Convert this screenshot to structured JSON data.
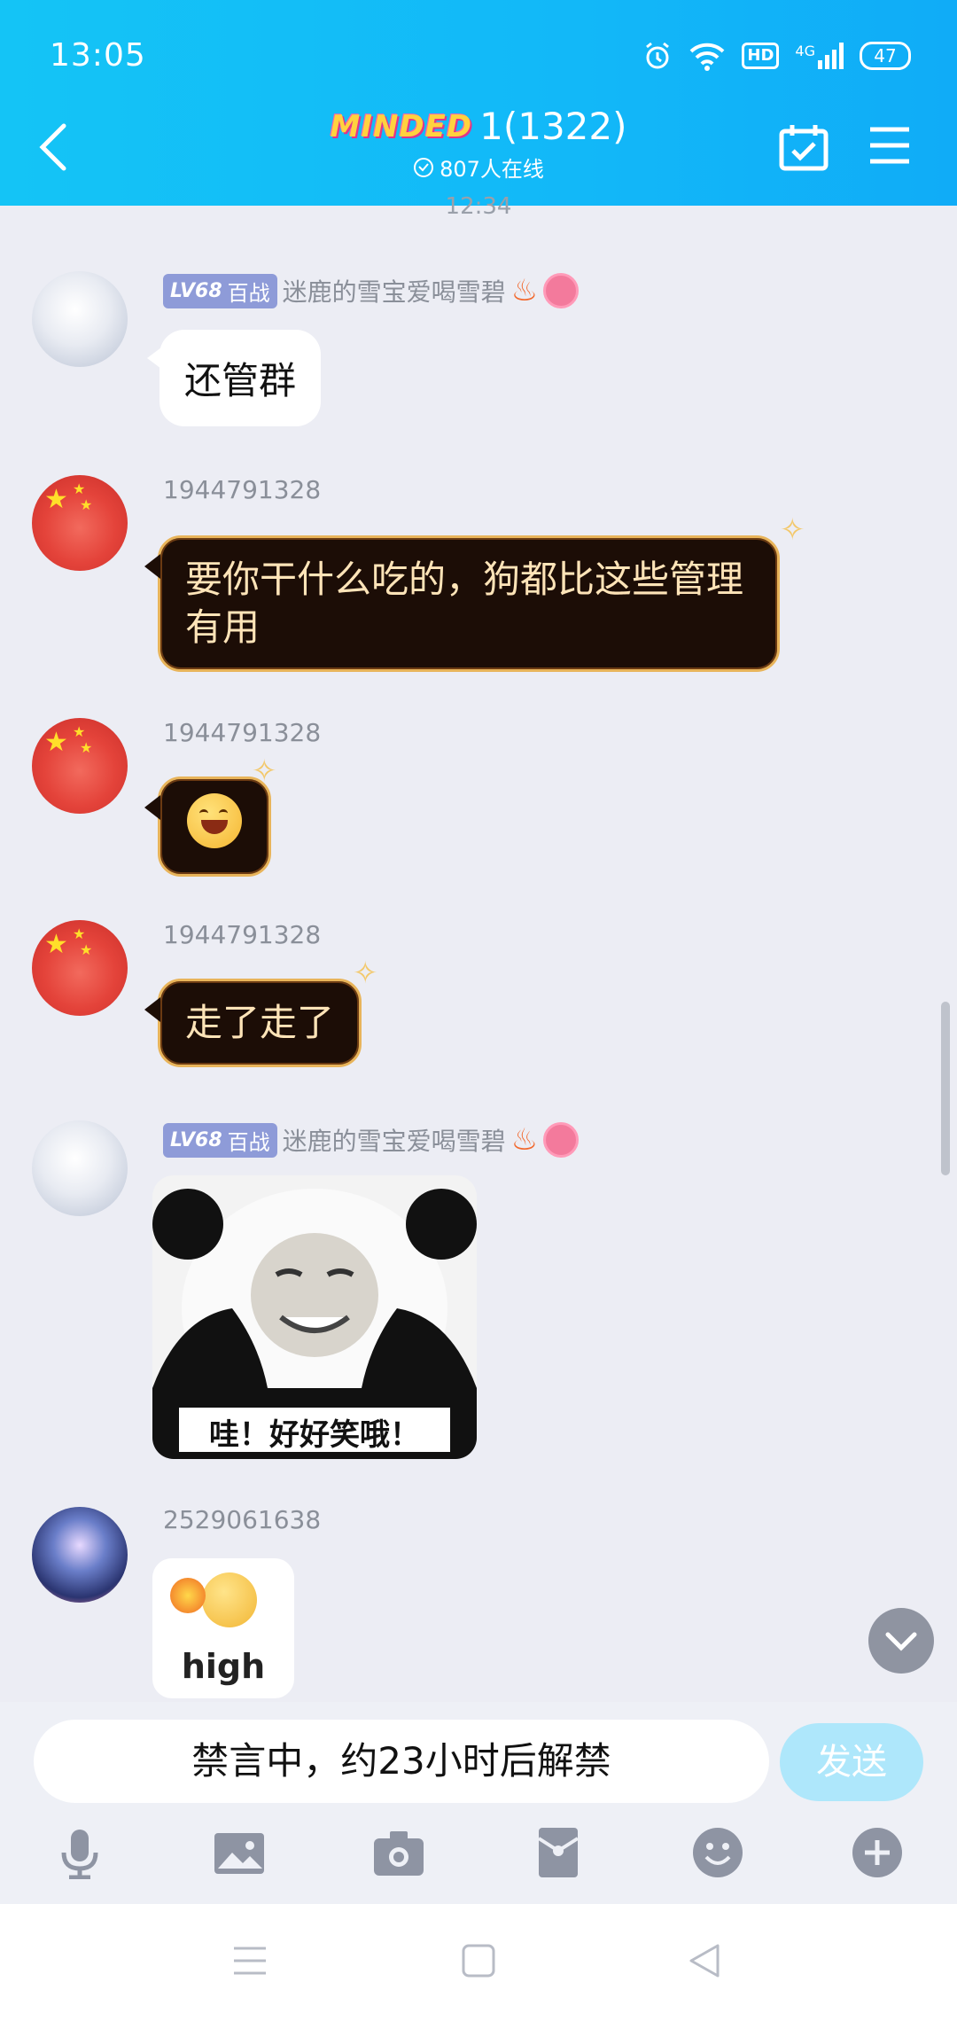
{
  "status": {
    "time": "13:05",
    "battery": "47",
    "network": "4G",
    "hd": "HD"
  },
  "header": {
    "logo": "MINDED",
    "title": "1(1322)",
    "online": "807人在线"
  },
  "timestamp": "12:34",
  "messages": [
    {
      "level": "LV68",
      "rank": "百战",
      "sender": "迷鹿的雪宝爱喝雪碧",
      "text": "还管群"
    },
    {
      "sender": "1944791328",
      "text": "要你干什么吃的，狗都比这些管理有用"
    },
    {
      "sender": "1944791328"
    },
    {
      "sender": "1944791328",
      "text": "走了走了"
    },
    {
      "level": "LV68",
      "rank": "百战",
      "sender": "迷鹿的雪宝爱喝雪碧",
      "sticker_text": "哇！好好笑哦！"
    },
    {
      "sender": "2529061638",
      "sticker_text": "high"
    }
  ],
  "input": {
    "placeholder": "禁言中，约23小时后解禁",
    "send_label": "发送"
  },
  "toolbar_icons": [
    "microphone-icon",
    "image-icon",
    "camera-icon",
    "red-packet-icon",
    "emoji-icon",
    "plus-icon"
  ],
  "colors": {
    "header": "#12b8f8",
    "send": "#aee7fb",
    "bubble_dark": "#1c0d06",
    "bubble_text_dark": "#ffe4b8"
  }
}
